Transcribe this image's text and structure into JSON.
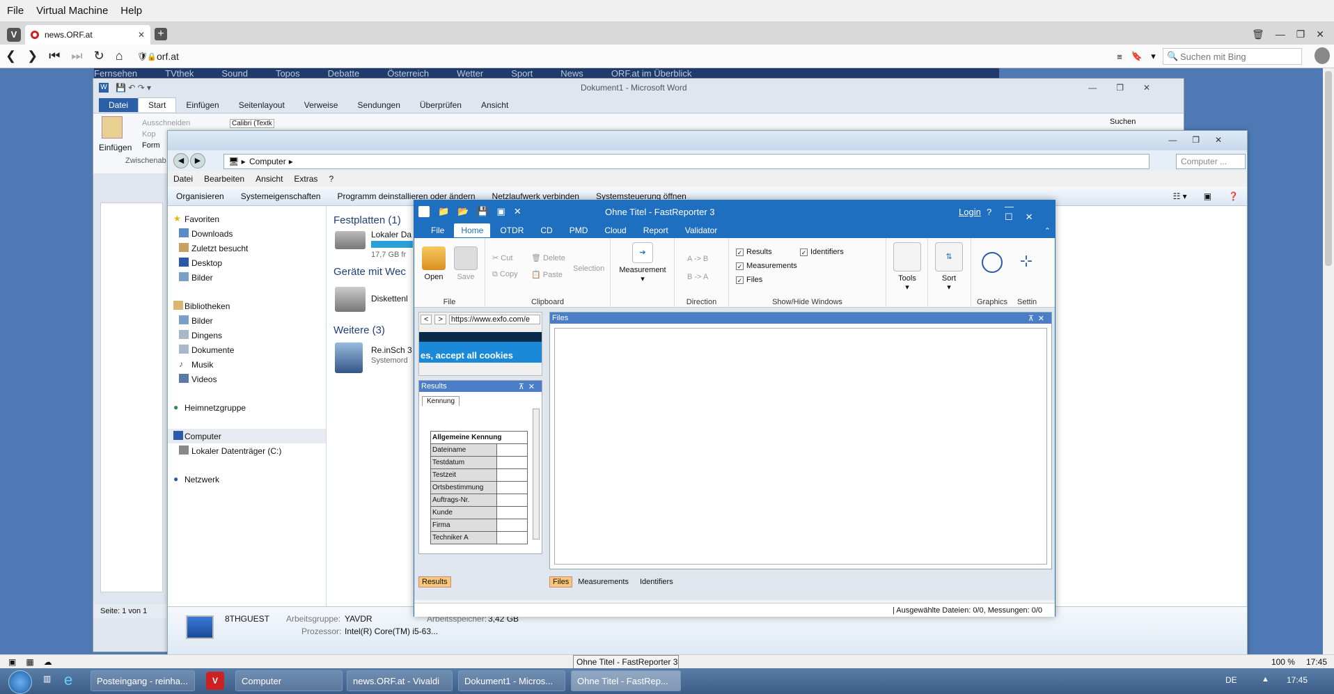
{
  "host_menu": [
    "File",
    "Virtual Machine",
    "Help"
  ],
  "vivaldi": {
    "tab_title": "news.ORF.at",
    "url": "orf.at",
    "search_placeholder": "Suchen mit Bing",
    "orf_nav": [
      "Fernsehen",
      "TVthek",
      "Sound",
      "Topos",
      "Debatte",
      "Österreich",
      "Wetter",
      "Sport",
      "News",
      "ORF.at im Überblick"
    ],
    "zoom": "100 %",
    "time": "17:45"
  },
  "word": {
    "title": "Dokument1 - Microsoft Word",
    "tabs": [
      "Datei",
      "Start",
      "Einfügen",
      "Seitenlayout",
      "Verweise",
      "Sendungen",
      "Überprüfen",
      "Ansicht"
    ],
    "einfuegen": "Einfügen",
    "ausschneiden": "Ausschneiden",
    "kopieren": "Kop",
    "format": "Form",
    "zwischenablage": "Zwischenab",
    "font": "Calibri (Textk",
    "suchen": "Suchen",
    "status_page": "Seite: 1 von 1"
  },
  "explorer": {
    "breadcrumb": "Computer",
    "search_placeholder": "Computer ...",
    "menu": [
      "Datei",
      "Bearbeiten",
      "Ansicht",
      "Extras",
      "?"
    ],
    "toolbar": [
      "Organisieren",
      "Systemeigenschaften",
      "Programm deinstallieren oder ändern",
      "Netzlaufwerk verbinden",
      "Systemsteuerung öffnen"
    ],
    "nav": {
      "favoriten": "Favoriten",
      "favoriten_items": [
        "Downloads",
        "Zuletzt besucht",
        "Desktop",
        "Bilder"
      ],
      "bibliotheken": "Bibliotheken",
      "bibliotheken_items": [
        "Bilder",
        "Dingens",
        "Dokumente",
        "Musik",
        "Videos"
      ],
      "heimnetz": "Heimnetzgruppe",
      "computer": "Computer",
      "computer_items": [
        "Lokaler Datenträger (C:)"
      ],
      "netzwerk": "Netzwerk"
    },
    "groups": {
      "festplatten": "Festplatten (1)",
      "lokaler": "Lokaler Da",
      "lokaler_size": "17,7 GB fr",
      "geraete": "Geräte mit Wec",
      "disketten": "Diskettenl",
      "weitere": "Weitere (3)",
      "reinsch": "Re.inSch 3",
      "systemord": "Systemord"
    },
    "details": {
      "name": "8THGUEST",
      "arbeitsgruppe_label": "Arbeitsgruppe:",
      "arbeitsgruppe": "YAVDR",
      "speicher_label": "Arbeitsspeicher:",
      "speicher": "3,42 GB",
      "prozessor_label": "Prozessor:",
      "prozessor": "Intel(R) Core(TM) i5-63..."
    }
  },
  "fastreporter": {
    "title": "Ohne Titel - FastReporter 3",
    "login": "Login",
    "help": "?",
    "tabs": [
      "File",
      "Home",
      "OTDR",
      "CD",
      "PMD",
      "Cloud",
      "Report",
      "Validator"
    ],
    "ribbon": {
      "open": "Open",
      "save": "Save",
      "file_group": "File",
      "cut": "Cut",
      "copy": "Copy",
      "delete": "Delete",
      "paste": "Paste",
      "selection": "Selection",
      "clipboard_group": "Clipboard",
      "measurement": "Measurement",
      "a_to_b": "A -> B",
      "b_to_a": "B -> A",
      "direction_group": "Direction",
      "results": "Results",
      "measurements": "Measurements",
      "files": "Files",
      "identifiers": "Identifiers",
      "showhide_group": "Show/Hide Windows",
      "tools": "Tools",
      "sort": "Sort",
      "graphics": "Graphics",
      "settings": "Settin"
    },
    "browser_url": "https://www.exfo.com/e",
    "cookie_text": "es, accept all cookies",
    "results_title": "Results",
    "kennung_tab": "Kennung",
    "results_table": {
      "header": "Allgemeine Kennung",
      "rows": [
        "Dateiname",
        "Testdatum",
        "Testzeit",
        "Ortsbestimmung",
        "Auftrags-Nr.",
        "Kunde",
        "Firma",
        "Techniker A"
      ]
    },
    "files_title": "Files",
    "bottom_left_tab": "Results",
    "bottom_tabs": [
      "Files",
      "Measurements",
      "Identifiers"
    ],
    "status": "| Ausgewählte Dateien: 0/0, Messungen: 0/0"
  },
  "taskbar": {
    "items": [
      "Posteingang - reinha...",
      "Computer",
      "news.ORF.at - Vivaldi",
      "Dokument1 - Micros...",
      "Ohne Titel - FastRep..."
    ],
    "tooltip": "Ohne Titel - FastReporter 3",
    "lang": "DE",
    "time": "17:45"
  }
}
